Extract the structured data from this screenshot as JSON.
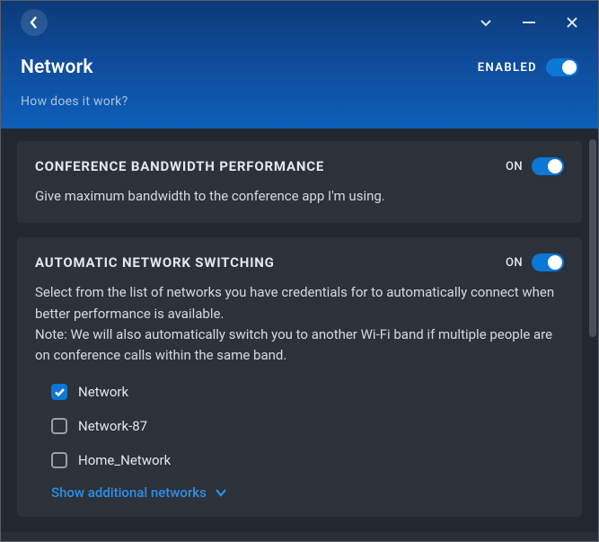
{
  "header": {
    "title": "Network",
    "enabled_label": "ENABLED",
    "how_link": "How does it work?"
  },
  "cards": {
    "bandwidth": {
      "title": "CONFERENCE BANDWIDTH PERFORMANCE",
      "toggle_label": "ON",
      "desc": "Give maximum bandwidth to the conference app I'm using."
    },
    "autoswitch": {
      "title": "AUTOMATIC NETWORK SWITCHING",
      "toggle_label": "ON",
      "desc": "Select from the list of networks you have credentials for to automatically connect when better performance is available.\nNote: We will also automatically switch you to another Wi-Fi band if multiple people are on conference calls within the same band.",
      "networks": [
        {
          "name": "Network",
          "checked": true
        },
        {
          "name": "Network-87",
          "checked": false
        },
        {
          "name": "Home_Network",
          "checked": false
        }
      ],
      "show_more": "Show additional networks"
    }
  }
}
